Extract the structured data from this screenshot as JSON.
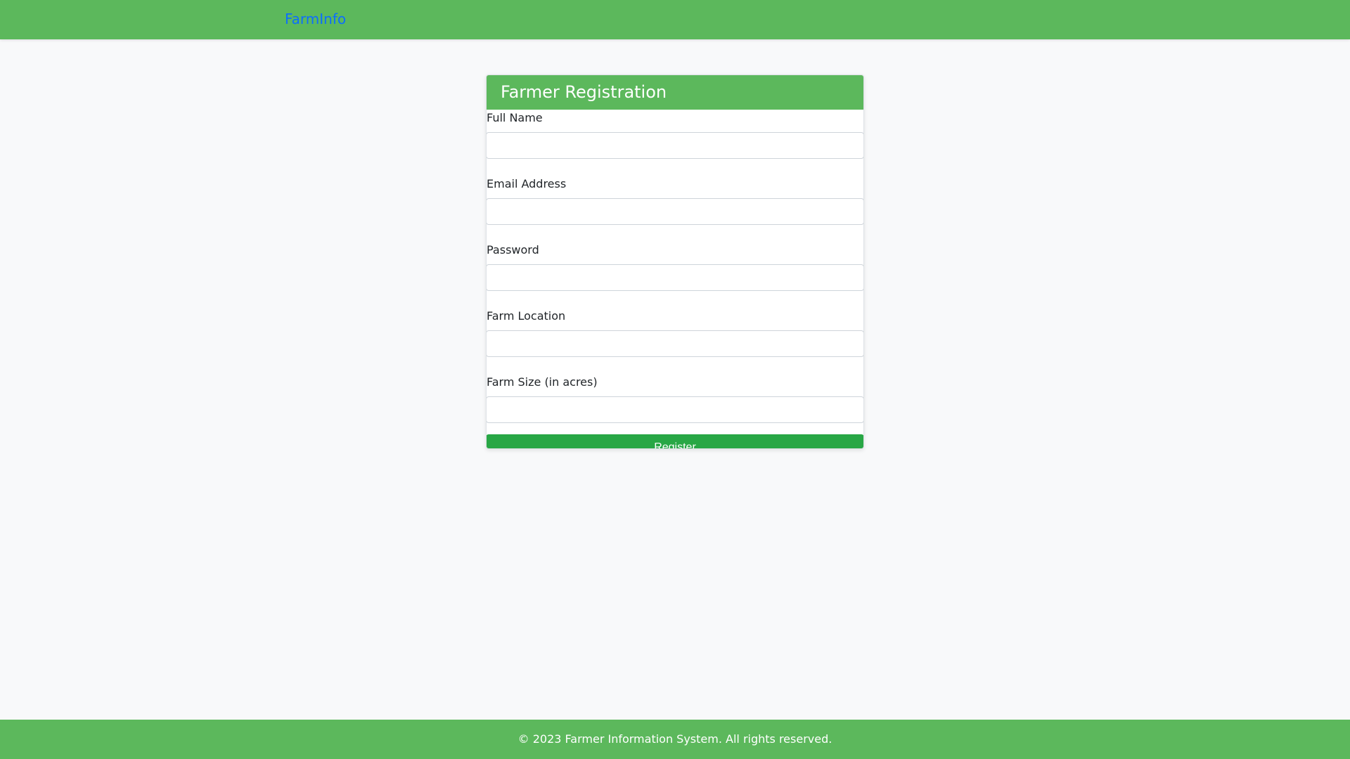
{
  "navbar": {
    "brand": "FarmInfo",
    "background_color": "#5cb85c",
    "brand_color": "#0d6efd"
  },
  "form": {
    "title": "Farmer Registration",
    "fields": [
      {
        "label": "Full Name",
        "value": "",
        "placeholder": ""
      },
      {
        "label": "Email Address",
        "value": "",
        "placeholder": ""
      },
      {
        "label": "Password",
        "value": "",
        "placeholder": ""
      },
      {
        "label": "Farm Location",
        "value": "",
        "placeholder": ""
      },
      {
        "label": "Farm Size (in acres)",
        "value": "",
        "placeholder": ""
      }
    ],
    "submit_label": "Register",
    "submit_color": "#28a745"
  },
  "footer": {
    "text": "© 2023 Farmer Information System. All rights reserved."
  }
}
